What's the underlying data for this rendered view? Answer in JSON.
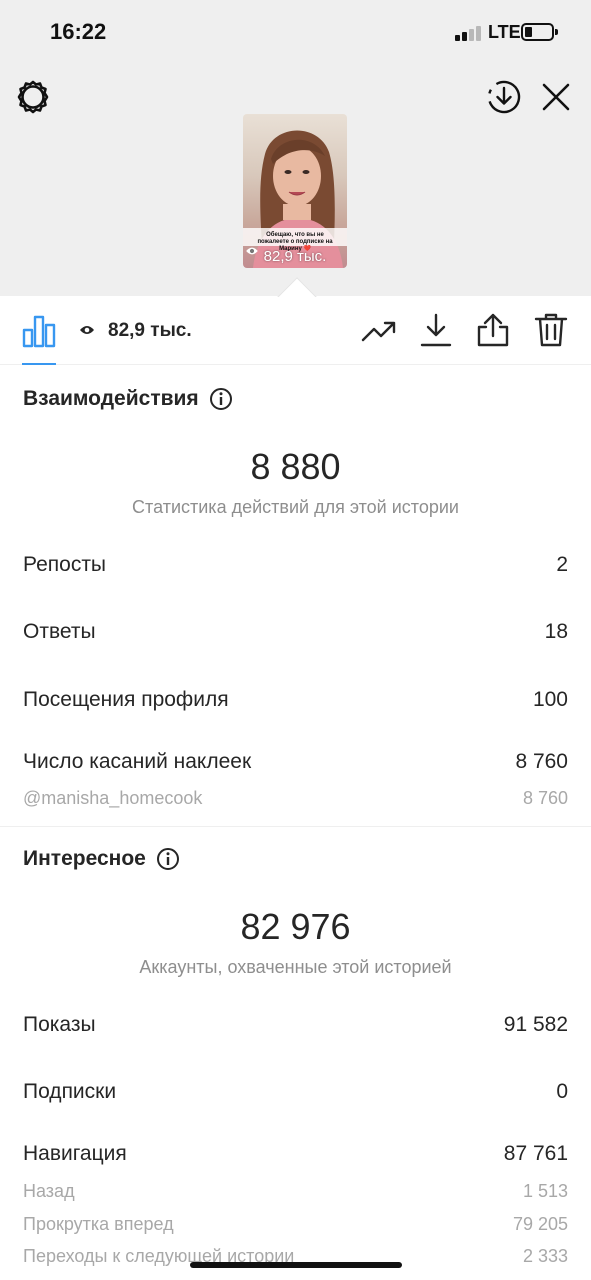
{
  "status_bar": {
    "time": "16:22",
    "network": "LTE"
  },
  "story": {
    "caption": "Обещаю, что вы не пожалеете о подписке на Марину ❤️",
    "views_overlay": "82,9 тыс."
  },
  "toolbar": {
    "views": "82,9 тыс."
  },
  "interactions": {
    "title": "Взаимодействия",
    "total": "8 880",
    "caption": "Статистика действий для этой истории",
    "rows": [
      {
        "label": "Репосты",
        "value": "2"
      },
      {
        "label": "Ответы",
        "value": "18"
      },
      {
        "label": "Посещения профиля",
        "value": "100"
      },
      {
        "label": "Число касаний наклеек",
        "value": "8 760"
      }
    ],
    "sticker_rows": [
      {
        "label": "@manisha_homecook",
        "value": "8 760"
      }
    ]
  },
  "discovery": {
    "title": "Интересное",
    "total": "82 976",
    "caption": "Аккаунты, охваченные этой историей",
    "rows": [
      {
        "label": "Показы",
        "value": "91 582"
      },
      {
        "label": "Подписки",
        "value": "0"
      },
      {
        "label": "Навигация",
        "value": "87 761"
      }
    ],
    "navigation_rows": [
      {
        "label": "Назад",
        "value": "1 513"
      },
      {
        "label": "Прокрутка вперед",
        "value": "79 205"
      },
      {
        "label": "Переходы к следующей истории",
        "value": "2 333"
      }
    ]
  },
  "colors": {
    "accent": "#3897f0",
    "text": "#262626",
    "secondary": "#8e8e8e"
  },
  "icons": [
    "settings-icon",
    "download-circle-icon",
    "close-icon",
    "chart-icon",
    "eye-icon",
    "trend-icon",
    "download-icon",
    "share-icon",
    "trash-icon",
    "info-icon"
  ]
}
